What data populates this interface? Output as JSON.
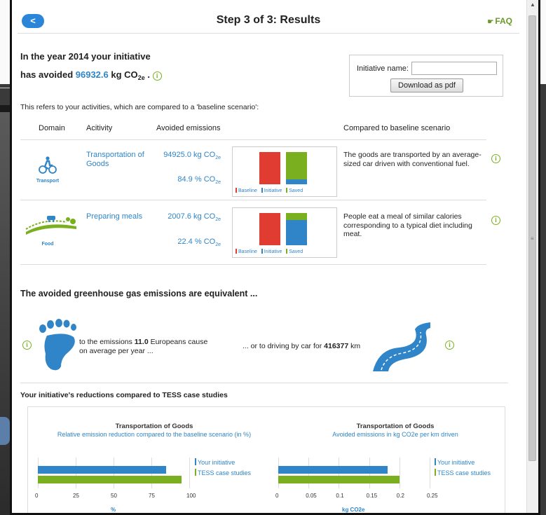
{
  "header": {
    "back_label": "<",
    "title": "Step 3 of 3: Results",
    "faq_label": "FAQ"
  },
  "summary": {
    "line1": "In the year 2014 your initiative",
    "line2_prefix": "has avoided",
    "value": "96932.6",
    "unit_main": "kg CO",
    "unit_sub": "2e",
    "suffix": "."
  },
  "initiative_box": {
    "label": "Initiative name:",
    "input_value": "",
    "pdf_button": "Download as pdf"
  },
  "refers_text": "This refers to your activities, which are compared to a 'baseline scenario':",
  "table": {
    "headers": [
      "Domain",
      "Acitivity",
      "Avoided emissions",
      "Compared to baseline scenario"
    ],
    "rows": [
      {
        "domain": "Transport",
        "activity_line1": "Transportation of",
        "activity_line2": "Goods",
        "kg_value": "94925.0",
        "kg_unit": "kg CO",
        "pct_value": "84.9",
        "pct_unit": "% CO",
        "unit_sub": "2e",
        "bars": {
          "baseline": 1.0,
          "initiative": 0.15,
          "saved": 0.85
        },
        "description": "The goods are transported by an average-sized car driven with conventional fuel."
      },
      {
        "domain": "Food",
        "activity_line1": "Preparing meals",
        "activity_line2": "",
        "kg_value": "2007.6",
        "kg_unit": "kg CO",
        "pct_value": "22.4",
        "pct_unit": "% CO",
        "unit_sub": "2e",
        "bars": {
          "baseline": 1.0,
          "initiative": 0.78,
          "saved": 0.22
        },
        "description": "People eat a meal of similar calories corresponding to a typical diet including meat."
      }
    ],
    "legend": [
      "Baseline",
      "Initiative",
      "Saved"
    ]
  },
  "equivalents": {
    "title": "The avoided greenhouse gas emissions are equivalent ...",
    "europeans_prefix": "to the emissions",
    "europeans_value": "11.0",
    "europeans_suffix": "Europeans cause",
    "europeans_line2": "on average per year ...",
    "driving_prefix": "... or to driving by car for",
    "driving_value": "416377",
    "driving_suffix": "km"
  },
  "tess": {
    "title": "Your initiative's reductions compared to TESS case studies",
    "legend": [
      "Your initiative",
      "TESS case studies"
    ]
  },
  "chart_data": [
    {
      "type": "bar",
      "title": "Transportation of Goods",
      "subtitle": "Relative emission reduction compared to the baseline scenario (in %)",
      "series": [
        {
          "name": "Your initiative",
          "values": [
            84.9
          ]
        },
        {
          "name": "TESS case studies",
          "values": [
            95
          ]
        }
      ],
      "xlim": [
        0,
        100
      ],
      "ticks": [
        "0",
        "25",
        "50",
        "75",
        "100"
      ],
      "xlabel": "%",
      "colors": {
        "Your initiative": "#2f85c8",
        "TESS case studies": "#7ab020"
      }
    },
    {
      "type": "bar",
      "title": "Transportation of Goods",
      "subtitle": "Avoided emissions in kg CO2e per km driven",
      "series": [
        {
          "name": "Your initiative",
          "values": [
            0.18
          ]
        },
        {
          "name": "TESS case studies",
          "values": [
            0.2
          ]
        }
      ],
      "xlim": [
        0,
        0.25
      ],
      "ticks": [
        "0",
        "0.05",
        "0.1",
        "0.15",
        "0.2",
        "0.25"
      ],
      "xlabel": "kg CO2e",
      "colors": {
        "Your initiative": "#2f85c8",
        "TESS case studies": "#7ab020"
      }
    }
  ],
  "colors": {
    "accent_blue": "#2f85c8",
    "green": "#7ab020",
    "baseline_red": "#e03c31"
  }
}
